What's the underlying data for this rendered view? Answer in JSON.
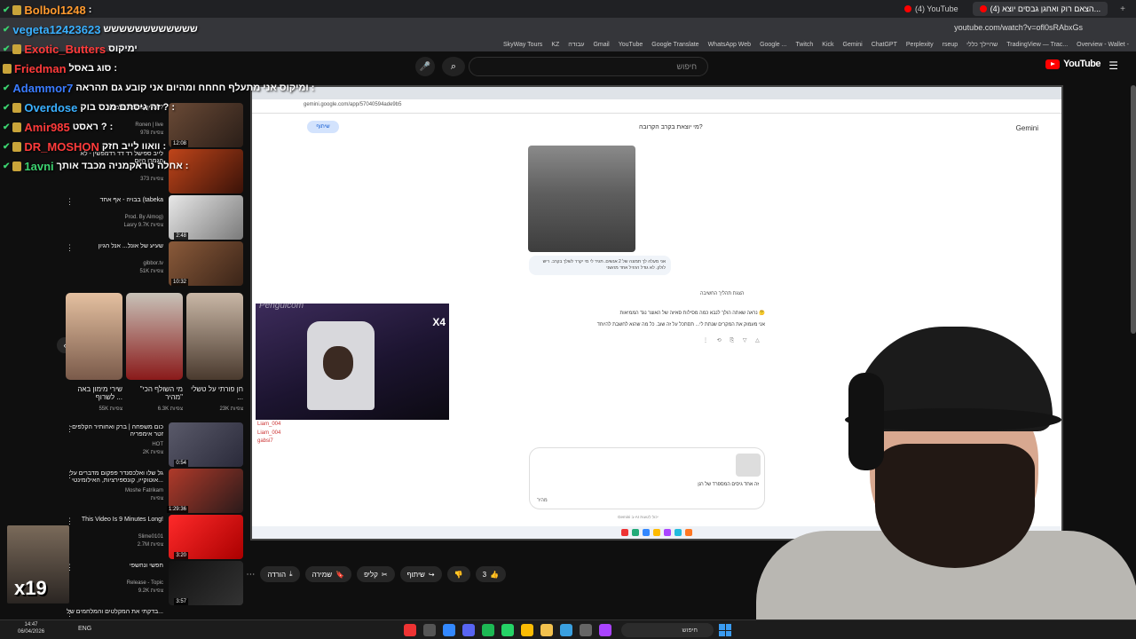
{
  "browser": {
    "tabs": [
      {
        "label": "(4) YouTube"
      },
      {
        "label": "(4) הצאם רוק ואחגן גבסים יוצא...",
        "active": true
      }
    ],
    "url": "youtube.com/watch?v=ofl0sRAbxGs",
    "bookmarks": [
      "Overview - Wallet -",
      "TradingView — Trac...",
      "שהיילך כללי",
      "rseup",
      "Perplexity",
      "ChatGPT",
      "Gemini",
      "Kick",
      "Twitch",
      "Google ...",
      "WhatsApp Web",
      "Google Translate",
      "YouTube",
      "Gmail",
      "עבודה",
      "KZ",
      "SkyWay Tours"
    ]
  },
  "youtube": {
    "search_placeholder": "חיפוש",
    "logo_text": "YouTube"
  },
  "chat": [
    {
      "user": "Bolbol1248",
      "text": ":",
      "color": "#ff9a2e"
    },
    {
      "user": "vegeta12423623",
      "text": "שששששששששששש",
      "color": "#3ab0ff"
    },
    {
      "user": "Exotic_Butters",
      "text": "ימיקוס",
      "color": "#ff3b3b"
    },
    {
      "user": "Friedman",
      "text": "סוג באסל :",
      "color": "#ff3b3b"
    },
    {
      "user": "Adammor7",
      "text": "ומיקוס אני מתעלף חחחח ומהיום אני קובע גם תהראה :",
      "color": "#3a7bff"
    },
    {
      "user": "Overdose",
      "text": "זה גיסתם מנס בוק ? :",
      "color": "#3ab0ff"
    },
    {
      "user": "Amir985",
      "text": "ראסט ? :",
      "color": "#ff3b3b"
    },
    {
      "user": "DR_MOSHON",
      "text": "וואוו לייב חזק :",
      "color": "#ff3b3b"
    },
    {
      "user": "1avni",
      "text": "אחלה טראקמניה מכבד אותך :",
      "color": "#3bd16f"
    }
  ],
  "recommendations": [
    {
      "title": "הנליך מטסר סלמסו?",
      "channel": "Ronen | live",
      "meta": "978 צפיות",
      "duration": "12:08"
    },
    {
      "title": "לייב ספישל רד דד רדמפשין - לא הגמרו היום",
      "channel": "",
      "meta": "373 צפיות",
      "duration": ""
    },
    {
      "title": "בבויה - אף אחד (tabeka",
      "channel": "Prod. By Almog)",
      "meta": "Lasry 9.7K צפיות",
      "duration": "2:48"
    },
    {
      "title": "שעיע של אונל... אנל הגיון",
      "channel": "gibbor.tv",
      "meta": "51K צפיות",
      "duration": "10:32"
    },
    {
      "title": "כום משפחה | ברק ואחותיר הקלפים- זטר אימפריה",
      "channel": "HOT",
      "meta": "2K צפיות",
      "duration": "0:54"
    },
    {
      "title": "גל שלו ואלכסנדר פפקום מדברים על אוטוקייו, קונספירציות, האילומינטי...",
      "channel": "Moshe Fatrikam",
      "meta": "צפיות",
      "duration": "1:29:36"
    },
    {
      "title": "This Video Is 9 Minutes Long!",
      "channel": "Slime0101",
      "meta": "2.7M צפיות",
      "duration": "3:20"
    },
    {
      "title": "חפשי ונחשפי",
      "channel": "Release - Topic",
      "meta": "9.2K צפיות",
      "duration": "3:57"
    },
    {
      "title": "בדקתי את המקלטים והמלחמים של...",
      "channel": "",
      "meta": "",
      "duration": ""
    }
  ],
  "shorts": [
    {
      "caption": "חן פורתי על טשלי ...",
      "views": "23K צפיות"
    },
    {
      "caption": "\"מי השולף הכי מהיר\"",
      "views": "6.3K צפיות"
    },
    {
      "caption": "שירי מימון באה לשרוף ...",
      "views": "55K צפיות"
    }
  ],
  "capture": {
    "url": "gemini.google.com/app/57040594ade9b5",
    "share_label": "שיתוף",
    "title": "מי יוצאת בקרב הקרובה?",
    "brand": "Gemini",
    "bubble_text": "אני מעלה לך תמונה של 2 אנשים. תגיד לי מי יקרר לשלך בקרב. ריש לולק. לא גודל הרגיל אחד מהשני",
    "thinking": "הצגת תהליך החשיבה",
    "answer_line1": "נראה שאתה הולך לנבא כמה מסילות סאיזה של האוצר נגד הממיאות 🤔",
    "answer_line2": "אני מעמוק את המקרים שנתת לי... תסתכל על זה שוב. כל מה שהוא לחשבת להיוחד",
    "input_text": "זה אחד גיסים המספרד של רגן",
    "tools_label": "מהיר",
    "disclaimer": "Gemini ב-AI יכול לטעות",
    "streamer_name": "Penguicom",
    "cam_badge": "X4",
    "cam_chat": [
      "Liam_004",
      "Liam_004",
      "gabsi7"
    ]
  },
  "controls": {
    "likes": "3",
    "share": "שיתוף",
    "clip": "קליפ",
    "save": "שמירה",
    "download": "הורדה"
  },
  "emote_text": "x19",
  "taskbar": {
    "time": "14:47",
    "date": "06/04/2026",
    "lang": "ENG",
    "search": "חיפוש"
  }
}
